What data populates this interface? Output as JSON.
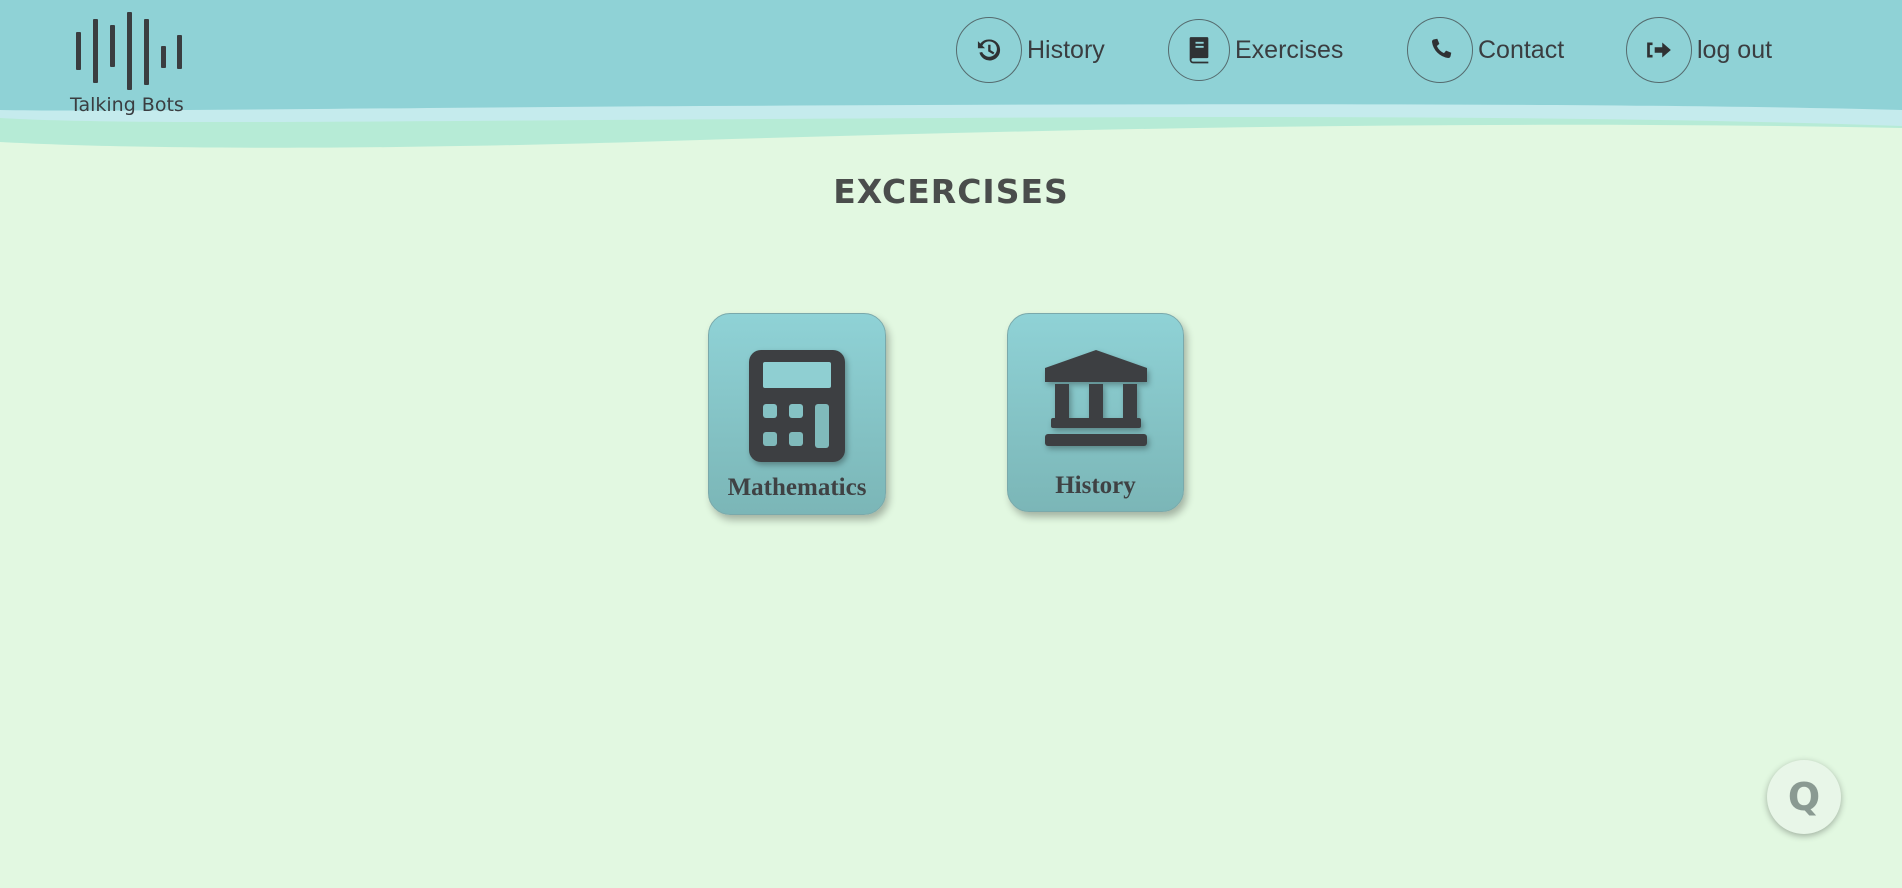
{
  "brand": {
    "name": "Talking Bots",
    "logo_icon": "sound-bars-logo"
  },
  "nav": [
    {
      "label": "History",
      "icon": "history-clock-icon"
    },
    {
      "label": "Exercises",
      "icon": "book-icon"
    },
    {
      "label": "Contact",
      "icon": "phone-icon"
    },
    {
      "label": "log out",
      "icon": "logout-arrow-icon"
    }
  ],
  "page": {
    "title": "EXCERCISES"
  },
  "cards": [
    {
      "label": "Mathematics",
      "icon": "calculator-icon"
    },
    {
      "label": "History",
      "icon": "landmark-icon"
    }
  ],
  "fab": {
    "glyph": "Q",
    "icon": "q-assistant-icon"
  },
  "colors": {
    "background": "#e2f8e1",
    "header": "#8fd2d6",
    "wave_light": "#c5ebed",
    "wave_mint": "#b6ebd6",
    "card_top": "#8fd2d6",
    "card_bottom": "#7bb6b7",
    "text_dark": "#3a3d40"
  }
}
